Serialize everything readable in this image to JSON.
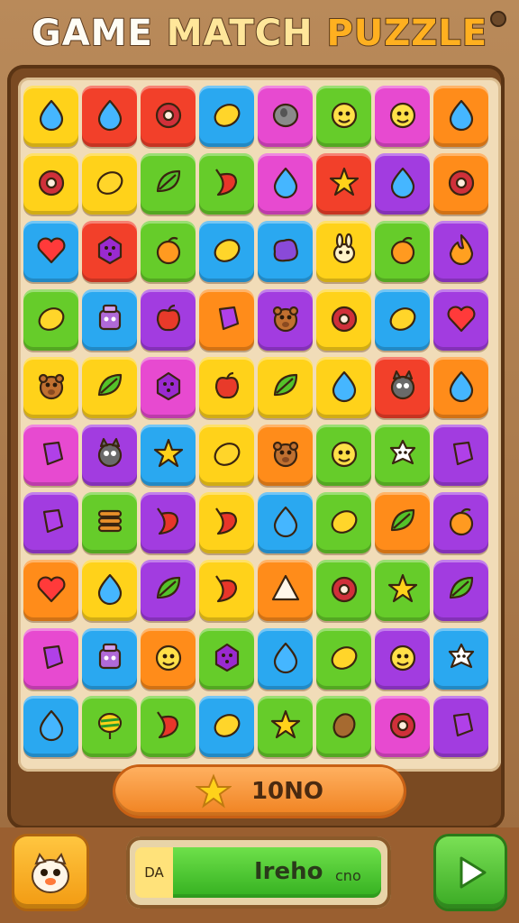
{
  "title": {
    "word1": "GAME",
    "word2": "MATCH",
    "word3": "PUZZLE"
  },
  "score": {
    "value": "10NO",
    "icon": "star-icon"
  },
  "progress": {
    "left_text": "DA",
    "label": "Ireho",
    "sub": "cno",
    "fill_fraction": 0.85
  },
  "buttons": {
    "character_icon": "owl-character-icon",
    "play_icon": "play-icon"
  },
  "colors": {
    "yellow": "#ffd21a",
    "red": "#f2402a",
    "blue": "#2aa8f0",
    "pink": "#e74ad0",
    "green": "#66cc2a",
    "purple": "#a23ce0",
    "orange": "#ff8c1a"
  },
  "board": [
    [
      "yellow",
      "red",
      "red",
      "blue",
      "pink",
      "green",
      "pink",
      "orange"
    ],
    [
      "yellow",
      "yellow",
      "green",
      "green",
      "pink",
      "red",
      "purple",
      "orange"
    ],
    [
      "blue",
      "red",
      "green",
      "blue",
      "blue",
      "yellow",
      "green",
      "purple"
    ],
    [
      "green",
      "blue",
      "purple",
      "orange",
      "purple",
      "yellow",
      "blue",
      "purple"
    ],
    [
      "yellow",
      "yellow",
      "pink",
      "yellow",
      "yellow",
      "yellow",
      "red",
      "orange"
    ],
    [
      "pink",
      "purple",
      "blue",
      "yellow",
      "orange",
      "green",
      "green",
      "purple"
    ],
    [
      "purple",
      "green",
      "purple",
      "yellow",
      "blue",
      "green",
      "orange",
      "purple"
    ],
    [
      "orange",
      "yellow",
      "purple",
      "yellow",
      "orange",
      "green",
      "green",
      "purple"
    ],
    [
      "pink",
      "blue",
      "orange",
      "green",
      "blue",
      "green",
      "purple",
      "blue"
    ],
    [
      "blue",
      "green",
      "green",
      "blue",
      "green",
      "green",
      "pink",
      "purple"
    ]
  ],
  "gem_icons": [
    [
      "drop-icon",
      "drop-icon",
      "ring-icon",
      "lemon-icon",
      "stone-icon",
      "face-icon",
      "face-icon",
      "drop-icon"
    ],
    [
      "ring-icon",
      "lemon-icon",
      "leaf-icon",
      "pepper-icon",
      "drop-icon",
      "star-icon",
      "drop-icon",
      "ring-icon"
    ],
    [
      "heart-icon",
      "berry-icon",
      "fruit-icon",
      "lemon-icon",
      "blob-icon",
      "bunny-icon",
      "fruit-icon",
      "flame-icon"
    ],
    [
      "lemon-icon",
      "robot-icon",
      "apple-icon",
      "gem-icon",
      "bear-icon",
      "ring-icon",
      "lemon-icon",
      "heart-icon"
    ],
    [
      "bear-icon",
      "leaf-icon",
      "berry-icon",
      "apple-icon",
      "leaf-icon",
      "drop-icon",
      "monster-icon",
      "drop-icon"
    ],
    [
      "gem-icon",
      "monster-icon",
      "star-icon",
      "lemon-icon",
      "bear-icon",
      "face-icon",
      "flower-icon",
      "gem-icon"
    ],
    [
      "gem-icon",
      "stack-icon",
      "pepper-icon",
      "pepper-icon",
      "drop-icon",
      "lemon-icon",
      "leaf-icon",
      "fruit-icon"
    ],
    [
      "heart-icon",
      "drop-icon",
      "leaf-icon",
      "pepper-icon",
      "triangle-icon",
      "ring-icon",
      "star-icon",
      "leaf-icon"
    ],
    [
      "gem-icon",
      "robot-icon",
      "face-icon",
      "berry-icon",
      "drop-icon",
      "lemon-icon",
      "face-icon",
      "flower-icon"
    ],
    [
      "drop-icon",
      "top-icon",
      "pepper-icon",
      "lemon-icon",
      "star-icon",
      "nut-icon",
      "ring-icon",
      "gem-icon"
    ]
  ]
}
